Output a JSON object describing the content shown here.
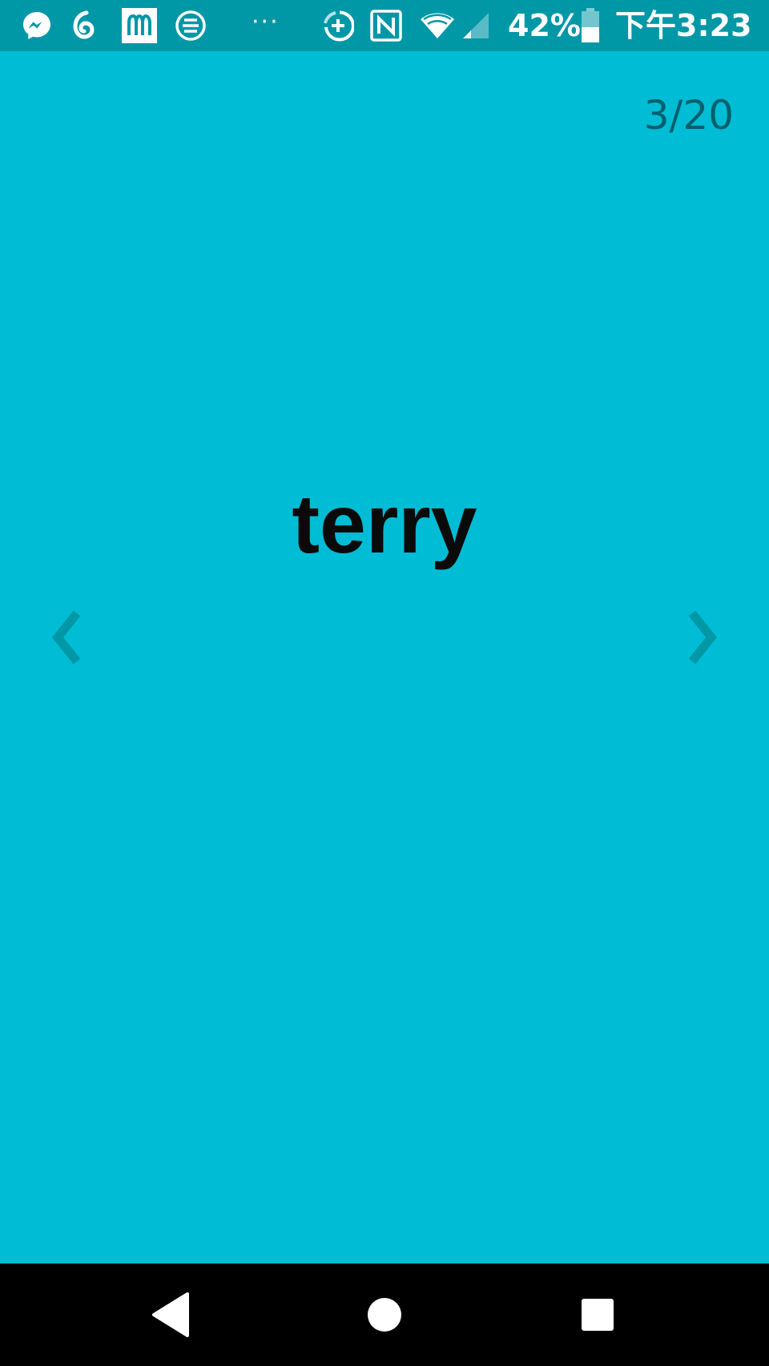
{
  "status_bar": {
    "notification_icons": [
      "messenger-icon",
      "spiral-app-icon",
      "mcdonalds-icon",
      "e-circle-app-icon"
    ],
    "overflow": "···",
    "system_icons": [
      "data-saver-icon",
      "nfc-icon",
      "wifi-icon",
      "cell-signal-icon",
      "battery-icon"
    ],
    "battery_level": "42%",
    "clock": "下午3:23"
  },
  "flashcard": {
    "counter": "3/20",
    "word": "terry"
  },
  "nav_arrows": {
    "prev_icon": "chevron-left-icon",
    "next_icon": "chevron-right-icon"
  },
  "navigation_bar": {
    "buttons": [
      "back-icon",
      "home-icon",
      "recents-icon"
    ]
  },
  "colors": {
    "background": "#00BCD4",
    "status_bar": "#0097A7",
    "arrow": "#0097A7",
    "nav_bar": "#000000"
  }
}
